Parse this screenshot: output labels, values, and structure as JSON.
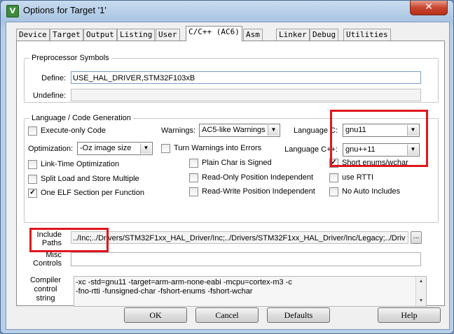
{
  "window": {
    "title": "Options for Target '1'",
    "close_glyph": "✕",
    "icon_glyph": "V"
  },
  "tabs": [
    "Device",
    "Target",
    "Output",
    "Listing",
    "User",
    "C/C++ (AC6)",
    "Asm",
    "Linker",
    "Debug",
    "Utilities"
  ],
  "active_tab": "C/C++ (AC6)",
  "preprocessor": {
    "legend": "Preprocessor Symbols",
    "define_label": "Define:",
    "define_value": "USE_HAL_DRIVER,STM32F103xB",
    "undefine_label": "Undefine:",
    "undefine_value": ""
  },
  "language": {
    "legend": "Language / Code Generation",
    "execute_only": {
      "label": "Execute-only Code",
      "checked": false
    },
    "warnings_label": "Warnings:",
    "warnings_value": "AC5-like Warnings",
    "language_c_label": "Language C:",
    "language_c_value": "gnu11",
    "optimization_label": "Optimization:",
    "optimization_value": "-Oz image size",
    "turn_warnings": {
      "label": "Turn Warnings into Errors",
      "checked": false
    },
    "language_cpp_label": "Language C++:",
    "language_cpp_value": "gnu++11",
    "link_time": {
      "label": "Link-Time Optimization",
      "checked": false
    },
    "plain_char": {
      "label": "Plain Char is Signed",
      "checked": false
    },
    "short_enums": {
      "label": "Short enums/wchar",
      "checked": true
    },
    "split_load": {
      "label": "Split Load and Store Multiple",
      "checked": false
    },
    "ro_position": {
      "label": "Read-Only Position Independent",
      "checked": false
    },
    "use_rtti": {
      "label": "use RTTI",
      "checked": false
    },
    "one_elf": {
      "label": "One ELF Section per Function",
      "checked": true
    },
    "rw_position": {
      "label": "Read-Write Position Independent",
      "checked": false
    },
    "no_auto_includes": {
      "label": "No Auto Includes",
      "checked": false
    }
  },
  "include_paths": {
    "label_line1": "Include",
    "label_line2": "Paths",
    "value": "../Inc;../Drivers/STM32F1xx_HAL_Driver/Inc;../Drivers/STM32F1xx_HAL_Driver/Inc/Legacy;../Driv",
    "browse_label": "..."
  },
  "misc_controls": {
    "label_line1": "Misc",
    "label_line2": "Controls",
    "value": ""
  },
  "compiler_string": {
    "label_line1": "Compiler",
    "label_line2": "control",
    "label_line3": "string",
    "line1": "-xc -std=gnu11 -target=arm-arm-none-eabi -mcpu=cortex-m3 -c",
    "line2": "-fno-rtti -funsigned-char -fshort-enums -fshort-wchar"
  },
  "buttons": {
    "ok": "OK",
    "cancel": "Cancel",
    "defaults": "Defaults",
    "help": "Help"
  },
  "colors": {
    "annotation_red": "#e0161e",
    "title_bar": "#b7cfe8",
    "close_button": "#c8442e"
  }
}
